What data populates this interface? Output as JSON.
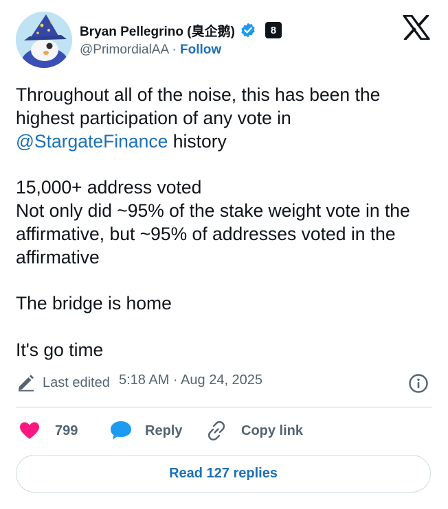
{
  "author": {
    "name": "Bryan Pellegrino (臭企鹅)",
    "handle": "@PrimordialAA",
    "separator": "·",
    "follow_label": "Follow",
    "affiliate_badge": "8",
    "avatar_icon": "wizard-penguin-avatar",
    "verified_icon": "verified-badge-icon"
  },
  "brand": {
    "logo": "x-logo-icon"
  },
  "tweet": {
    "line1_before": "Throughout all of the noise, this has been the highest participation of any vote in ",
    "mention": "@StargateFinance",
    "line1_after": " history",
    "para2_line1": "15,000+ address voted",
    "para2_line2": "Not only did ~95% of the stake weight vote in the affirmative, but ~95% of addresses voted in the affirmative",
    "para3": "The bridge is home",
    "para4": "It's go time"
  },
  "meta": {
    "edited_label": "Last edited",
    "timestamp": "5:18 AM · Aug 24, 2025"
  },
  "actions": {
    "like_count": "799",
    "reply_label": "Reply",
    "copy_label": "Copy link"
  },
  "read_replies_label": "Read 127 replies",
  "colors": {
    "link": "#1d70b8",
    "verified": "#1d9bf0",
    "like": "#f91880",
    "text": "#0f1419",
    "muted": "#536471"
  }
}
